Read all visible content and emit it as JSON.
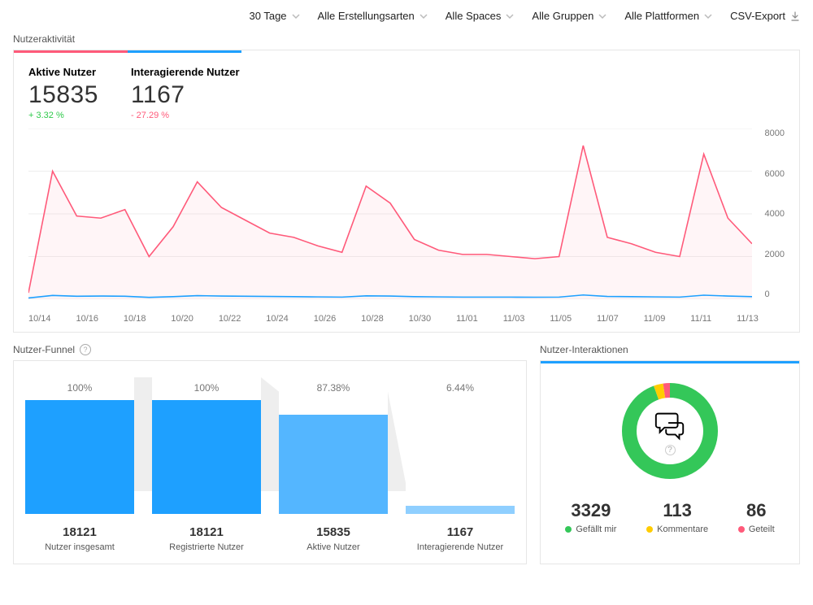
{
  "filters": {
    "range": "30 Tage",
    "creation": "Alle Erstellungsarten",
    "spaces": "Alle Spaces",
    "groups": "Alle Gruppen",
    "platforms": "Alle Plattformen",
    "csv": "CSV-Export"
  },
  "activity": {
    "section_title": "Nutzeraktivität",
    "kpi1_label": "Aktive Nutzer",
    "kpi1_value": "15835",
    "kpi1_change": "+ 3.32 %",
    "kpi2_label": "Interagierende Nutzer",
    "kpi2_value": "1167",
    "kpi2_change": "- 27.29 %"
  },
  "funnel": {
    "section_title": "Nutzer-Funnel",
    "col1_pct": "100%",
    "col1_num": "18121",
    "col1_cap": "Nutzer insgesamt",
    "col2_pct": "100%",
    "col2_num": "18121",
    "col2_cap": "Registrierte Nutzer",
    "col3_pct": "87.38%",
    "col3_num": "15835",
    "col3_cap": "Aktive Nutzer",
    "col4_pct": "6.44%",
    "col4_num": "1167",
    "col4_cap": "Interagierende Nutzer"
  },
  "interactions": {
    "section_title": "Nutzer-Interaktionen",
    "likes_num": "3329",
    "likes_lab": "Gefällt mir",
    "comments_num": "113",
    "comments_lab": "Kommentare",
    "shares_num": "86",
    "shares_lab": "Geteilt"
  },
  "chart_data": [
    {
      "type": "line",
      "title": "Nutzeraktivität",
      "ylabel": "",
      "xlabel": "",
      "ylim": [
        0,
        8000
      ],
      "x_tick_labels": [
        "10/14",
        "10/16",
        "10/18",
        "10/20",
        "10/22",
        "10/24",
        "10/26",
        "10/28",
        "10/30",
        "11/01",
        "11/03",
        "11/05",
        "11/07",
        "11/09",
        "11/11",
        "11/13"
      ],
      "y_tick_labels": [
        "0",
        "2000",
        "4000",
        "6000",
        "8000"
      ],
      "categories": [
        "10/14",
        "10/15",
        "10/16",
        "10/17",
        "10/18",
        "10/19",
        "10/20",
        "10/21",
        "10/22",
        "10/23",
        "10/24",
        "10/25",
        "10/26",
        "10/27",
        "10/28",
        "10/29",
        "10/30",
        "10/31",
        "11/01",
        "11/02",
        "11/03",
        "11/04",
        "11/05",
        "11/06",
        "11/07",
        "11/08",
        "11/09",
        "11/10",
        "11/11",
        "11/12",
        "11/13"
      ],
      "series": [
        {
          "name": "Aktive Nutzer",
          "color": "#ff5a7a",
          "values": [
            300,
            6000,
            3900,
            3800,
            4200,
            2000,
            3400,
            5500,
            4300,
            3700,
            3100,
            2900,
            2500,
            2200,
            5300,
            4500,
            2800,
            2300,
            2100,
            2100,
            2000,
            1900,
            2000,
            7200,
            2900,
            2600,
            2200,
            2000,
            6800,
            3800,
            2600
          ]
        },
        {
          "name": "Interagierende Nutzer",
          "color": "#1ea0ff",
          "values": [
            60,
            180,
            140,
            150,
            140,
            90,
            120,
            170,
            150,
            140,
            130,
            120,
            110,
            100,
            160,
            150,
            120,
            110,
            100,
            100,
            100,
            95,
            100,
            200,
            130,
            120,
            110,
            100,
            190,
            150,
            120
          ]
        }
      ]
    },
    {
      "type": "bar",
      "title": "Nutzer-Funnel",
      "categories": [
        "Nutzer insgesamt",
        "Registrierte Nutzer",
        "Aktive Nutzer",
        "Interagierende Nutzer"
      ],
      "values": [
        18121,
        18121,
        15835,
        1167
      ],
      "percentages": [
        100,
        100,
        87.38,
        6.44
      ]
    },
    {
      "type": "pie",
      "title": "Nutzer-Interaktionen",
      "series": [
        {
          "name": "Gefällt mir",
          "value": 3329,
          "color": "#34c759"
        },
        {
          "name": "Kommentare",
          "value": 113,
          "color": "#ffcc00"
        },
        {
          "name": "Geteilt",
          "value": 86,
          "color": "#ff5a7a"
        }
      ]
    }
  ]
}
